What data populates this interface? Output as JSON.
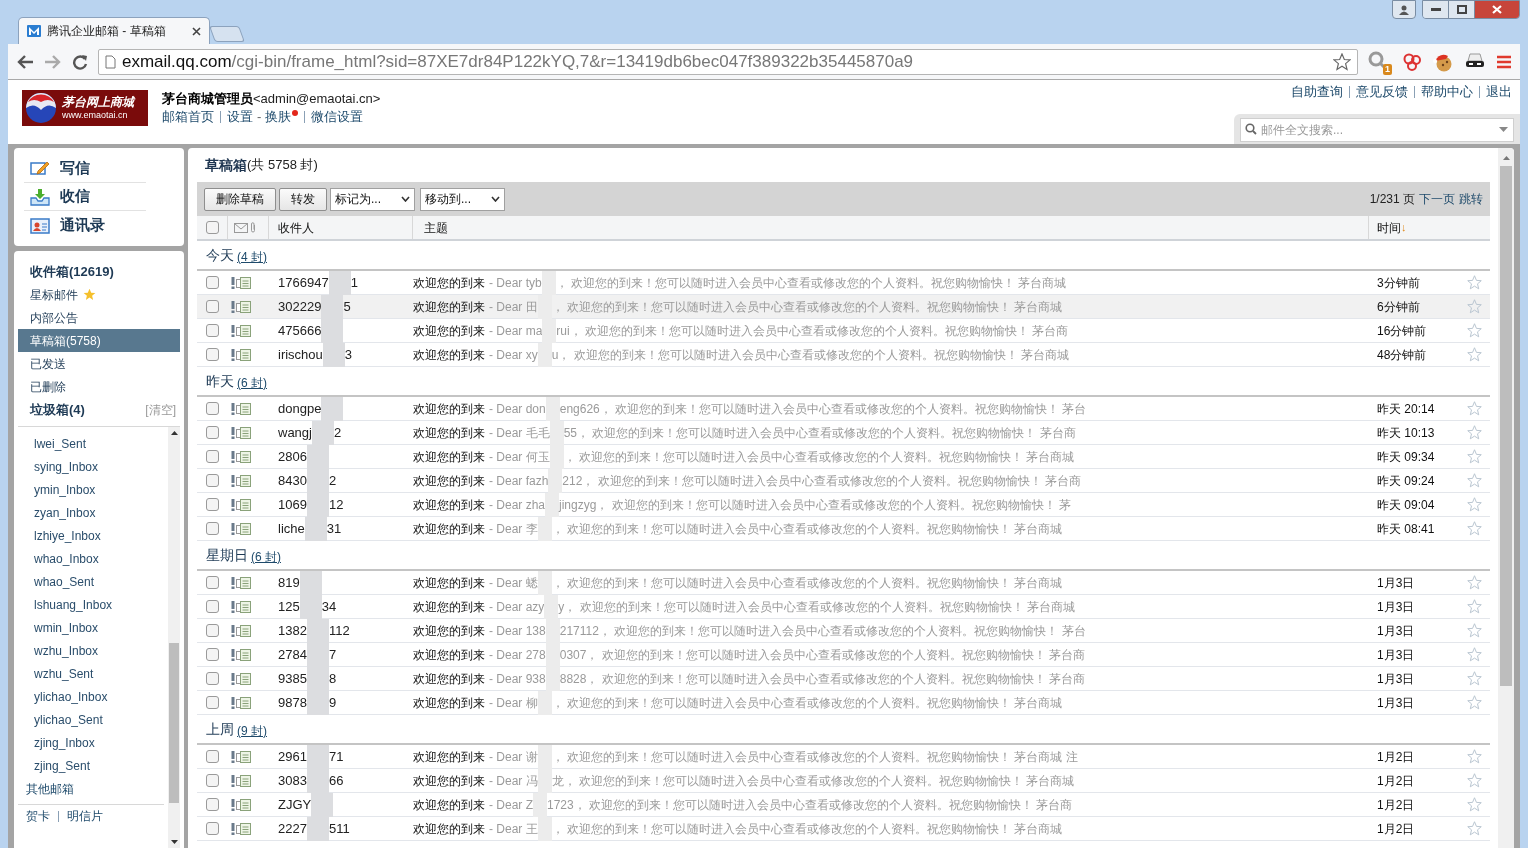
{
  "browser": {
    "tab_title": "腾讯企业邮箱 - 草稿箱",
    "url_host": "exmail.qq.com",
    "url_path": "/cgi-bin/frame_html?sid=87XE7dr84P122kYQ,7&r=13419db6bec047f389322b35445870a9",
    "extension_badge": "1"
  },
  "header": {
    "logo_title": "茅台网上商城",
    "logo_url": "www.emaotai.cn",
    "user_name": "茅台商城管理员",
    "user_email": "<admin@emaotai.cn>",
    "nav": [
      {
        "kind": "link",
        "text": "邮箱首页"
      },
      {
        "kind": "divider"
      },
      {
        "kind": "link",
        "text": "设置"
      },
      {
        "kind": "sep",
        "text": "-"
      },
      {
        "kind": "link",
        "text": "换肤",
        "dot": true
      },
      {
        "kind": "divider"
      },
      {
        "kind": "link",
        "text": "微信设置"
      }
    ],
    "top_links": [
      "自助查询",
      "意见反馈",
      "帮助中心",
      "退出"
    ],
    "search": {
      "placeholder": "邮件全文搜索..."
    }
  },
  "sidebar": {
    "actions": [
      {
        "kind": "compose",
        "label": "写信"
      },
      {
        "kind": "receive",
        "label": "收信"
      },
      {
        "kind": "contacts",
        "label": "通讯录"
      }
    ],
    "folders": [
      {
        "label": "收件箱(12619)",
        "bold": true,
        "selected": false,
        "kind": "plain"
      },
      {
        "label": "星标邮件",
        "bold": false,
        "selected": false,
        "kind": "starred"
      },
      {
        "label": "内部公告",
        "bold": false,
        "selected": false,
        "kind": "plain"
      },
      {
        "label": "草稿箱(5758)",
        "bold": false,
        "selected": true,
        "kind": "plain"
      },
      {
        "label": "已发送",
        "bold": false,
        "selected": false,
        "kind": "plain"
      },
      {
        "label": "已删除",
        "bold": false,
        "selected": false,
        "kind": "plain"
      },
      {
        "label": "垃圾箱(4)",
        "bold": true,
        "selected": false,
        "kind": "trash",
        "action": "[清空]"
      }
    ],
    "custom_folders": [
      "lwei_Sent",
      "sying_Inbox",
      "ymin_Inbox",
      "zyan_Inbox",
      "lzhiye_Inbox",
      "whao_Inbox",
      "whao_Sent",
      "lshuang_Inbox",
      "wmin_Inbox",
      "wzhu_Inbox",
      "wzhu_Sent",
      "ylichao_Inbox",
      "ylichao_Sent",
      "zjing_Inbox",
      "zjing_Sent"
    ],
    "other_mailboxes": "其他邮箱",
    "bottom_links": [
      "贺卡",
      "明信片"
    ]
  },
  "mail": {
    "title": "草稿箱",
    "count": "(共 5758 封)",
    "buttons": [
      "删除草稿",
      "转发"
    ],
    "dropdowns": [
      "标记为...",
      "移动到..."
    ],
    "pager": {
      "page": "1/231 页",
      "next": "下一页",
      "jump": "跳转"
    },
    "columns": {
      "select_all_checked": false,
      "recipient": "收件人",
      "subject": "主题",
      "time": "时间",
      "sort_mark": "↓"
    },
    "groups": [
      {
        "title": "今天",
        "count": "(4 封)",
        "rows": [
          {
            "recipient_start": "1766947",
            "recipient_end": "1",
            "subject": "欢迎您的到来",
            "preview_start": "- Dear tyb",
            "preview_end": "， 欢迎您的到来！您可以随时进入会员中心查看或修改您的个人资料。祝您购物愉快！ 茅台商城",
            "time": "3分钟前",
            "highlighted": false,
            "checked": false,
            "starred": false
          },
          {
            "recipient_start": "302229",
            "recipient_end": "5",
            "subject": "欢迎您的到来",
            "preview_start": "- Dear 田",
            "preview_end": "， 欢迎您的到来！您可以随时进入会员中心查看或修改您的个人资料。祝您购物愉快！ 茅台商城",
            "time": "6分钟前",
            "highlighted": true,
            "checked": false,
            "starred": false
          },
          {
            "recipient_start": "475666",
            "recipient_end": "",
            "subject": "欢迎您的到来",
            "preview_start": "- Dear ma",
            "preview_end": "rui， 欢迎您的到来！您可以随时进入会员中心查看或修改您的个人资料。祝您购物愉快！ 茅台商",
            "time": "16分钟前",
            "highlighted": false,
            "checked": false,
            "starred": false
          },
          {
            "recipient_start": "irischou",
            "recipient_end": "3",
            "subject": "欢迎您的到来",
            "preview_start": "- Dear xy",
            "preview_end": "u， 欢迎您的到来！您可以随时进入会员中心查看或修改您的个人资料。祝您购物愉快！ 茅台商城",
            "time": "48分钟前",
            "highlighted": false,
            "checked": false,
            "starred": false
          }
        ]
      },
      {
        "title": "昨天",
        "count": "(6 封)",
        "rows": [
          {
            "recipient_start": "dongpe",
            "recipient_end": "",
            "subject": "欢迎您的到来",
            "preview_start": "- Dear don",
            "preview_end": "eng626， 欢迎您的到来！您可以随时进入会员中心查看或修改您的个人资料。祝您购物愉快！ 茅台",
            "time": "昨天 20:14",
            "highlighted": false,
            "checked": false,
            "starred": false
          },
          {
            "recipient_start": "wangj",
            "recipient_end": "2",
            "subject": "欢迎您的到来",
            "preview_start": "- Dear 毛毛",
            "preview_end": "55， 欢迎您的到来！您可以随时进入会员中心查看或修改您的个人资料。祝您购物愉快！ 茅台商",
            "time": "昨天 10:13",
            "highlighted": false,
            "checked": false,
            "starred": false
          },
          {
            "recipient_start": "2806",
            "recipient_end": "",
            "subject": "欢迎您的到来",
            "preview_start": "- Dear 何玉",
            "preview_end": "， 欢迎您的到来！您可以随时进入会员中心查看或修改您的个人资料。祝您购物愉快！ 茅台商城",
            "time": "昨天 09:34",
            "highlighted": false,
            "checked": false,
            "starred": false
          },
          {
            "recipient_start": "8430",
            "recipient_end": "2",
            "subject": "欢迎您的到来",
            "preview_start": "- Dear fazh",
            "preview_end": "212， 欢迎您的到来！您可以随时进入会员中心查看或修改您的个人资料。祝您购物愉快！ 茅台商",
            "time": "昨天 09:24",
            "highlighted": false,
            "checked": false,
            "starred": false
          },
          {
            "recipient_start": "1069",
            "recipient_end": "12",
            "subject": "欢迎您的到来",
            "preview_start": "- Dear zha",
            "preview_end": "jingzyg， 欢迎您的到来！您可以随时进入会员中心查看或修改您的个人资料。祝您购物愉快！ 茅",
            "time": "昨天 09:04",
            "highlighted": false,
            "checked": false,
            "starred": false
          },
          {
            "recipient_start": "liche",
            "recipient_end": "31",
            "subject": "欢迎您的到来",
            "preview_start": "- Dear 李",
            "preview_end": "， 欢迎您的到来！您可以随时进入会员中心查看或修改您的个人资料。祝您购物愉快！ 茅台商城",
            "time": "昨天 08:41",
            "highlighted": false,
            "checked": false,
            "starred": false
          }
        ]
      },
      {
        "title": "星期日",
        "count": "(6 封)",
        "rows": [
          {
            "recipient_start": "819",
            "recipient_end": "",
            "subject": "欢迎您的到来",
            "preview_start": "- Dear 蟋",
            "preview_end": "， 欢迎您的到来！您可以随时进入会员中心查看或修改您的个人资料。祝您购物愉快！ 茅台商城",
            "time": "1月3日",
            "highlighted": false,
            "checked": false,
            "starred": false
          },
          {
            "recipient_start": "125",
            "recipient_end": "34",
            "subject": "欢迎您的到来",
            "preview_start": "- Dear azy",
            "preview_end": "y， 欢迎您的到来！您可以随时进入会员中心查看或修改您的个人资料。祝您购物愉快！ 茅台商城",
            "time": "1月3日",
            "highlighted": false,
            "checked": false,
            "starred": false
          },
          {
            "recipient_start": "1382",
            "recipient_end": "112",
            "subject": "欢迎您的到来",
            "preview_start": "- Dear 138",
            "preview_end": "217112， 欢迎您的到来！您可以随时进入会员中心查看或修改您的个人资料。祝您购物愉快！ 茅台",
            "time": "1月3日",
            "highlighted": false,
            "checked": false,
            "starred": false
          },
          {
            "recipient_start": "2784",
            "recipient_end": "7",
            "subject": "欢迎您的到来",
            "preview_start": "- Dear 278",
            "preview_end": "0307， 欢迎您的到来！您可以随时进入会员中心查看或修改您的个人资料。祝您购物愉快！ 茅台商",
            "time": "1月3日",
            "highlighted": false,
            "checked": false,
            "starred": false
          },
          {
            "recipient_start": "9385",
            "recipient_end": "8",
            "subject": "欢迎您的到来",
            "preview_start": "- Dear 938",
            "preview_end": "8828， 欢迎您的到来！您可以随时进入会员中心查看或修改您的个人资料。祝您购物愉快！ 茅台商",
            "time": "1月3日",
            "highlighted": false,
            "checked": false,
            "starred": false
          },
          {
            "recipient_start": "9878",
            "recipient_end": "9",
            "subject": "欢迎您的到来",
            "preview_start": "- Dear 柳",
            "preview_end": "， 欢迎您的到来！您可以随时进入会员中心查看或修改您的个人资料。祝您购物愉快！ 茅台商城",
            "time": "1月3日",
            "highlighted": false,
            "checked": false,
            "starred": false
          }
        ]
      },
      {
        "title": "上周",
        "count": "(9 封)",
        "rows": [
          {
            "recipient_start": "2961",
            "recipient_end": "71",
            "subject": "欢迎您的到来",
            "preview_start": "- Dear 谢",
            "preview_end": "， 欢迎您的到来！您可以随时进入会员中心查看或修改您的个人资料。祝您购物愉快！ 茅台商城 注",
            "time": "1月2日",
            "highlighted": false,
            "checked": false,
            "starred": false
          },
          {
            "recipient_start": "3083",
            "recipient_end": "66",
            "subject": "欢迎您的到来",
            "preview_start": "- Dear 冯",
            "preview_end": "龙， 欢迎您的到来！您可以随时进入会员中心查看或修改您的个人资料。祝您购物愉快！ 茅台商城",
            "time": "1月2日",
            "highlighted": false,
            "checked": false,
            "starred": false
          },
          {
            "recipient_start": "ZJGY",
            "recipient_end": "",
            "subject": "欢迎您的到来",
            "preview_start": "- Dear Z",
            "preview_end": "1723， 欢迎您的到来！您可以随时进入会员中心查看或修改您的个人资料。祝您购物愉快！ 茅台商",
            "time": "1月2日",
            "highlighted": false,
            "checked": false,
            "starred": false
          },
          {
            "recipient_start": "2227",
            "recipient_end": "511",
            "subject": "欢迎您的到来",
            "preview_start": "- Dear 王",
            "preview_end": "， 欢迎您的到来！您可以随时进入会员中心查看或修改您的个人资料。祝您购物愉快！ 茅台商城",
            "time": "1月2日",
            "highlighted": false,
            "checked": false,
            "starred": false
          }
        ]
      }
    ]
  }
}
